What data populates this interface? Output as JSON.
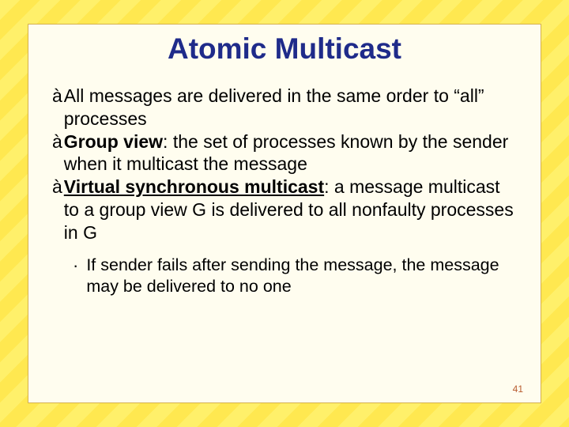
{
  "slide": {
    "title": "Atomic Multicast",
    "bullets": [
      {
        "prefix": "",
        "bold": null,
        "text": "All messages are delivered in the same order to “all” processes"
      },
      {
        "prefix": "",
        "bold": "Group view",
        "sep": ": ",
        "text": "the set of processes known by the sender when it multicast the message"
      },
      {
        "prefix": "",
        "bold_u": "Virtual synchronous multicast",
        "sep": ": ",
        "text": "a message multicast to a group view G is delivered to all nonfaulty processes in G"
      }
    ],
    "subbullets": [
      {
        "text": "If sender fails after sending the message, the message may be delivered to no one"
      }
    ],
    "page": "41"
  }
}
